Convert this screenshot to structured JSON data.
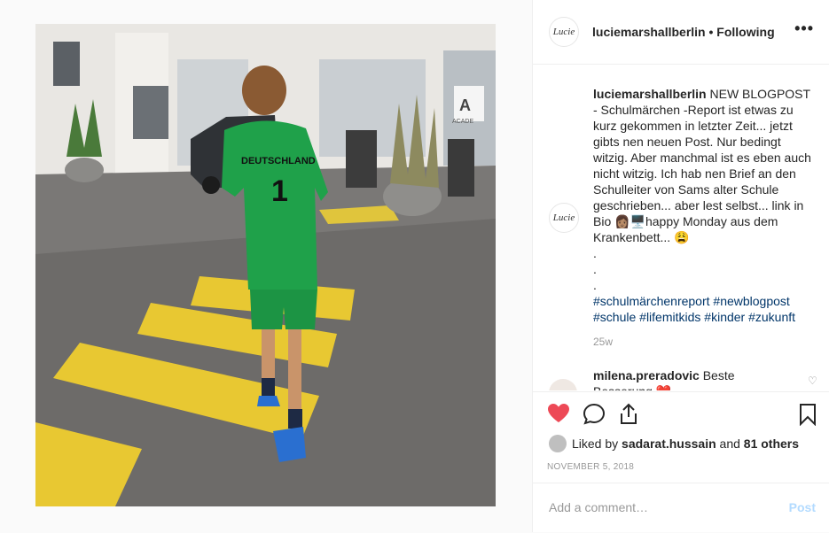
{
  "post": {
    "account": "luciemarshallberlin",
    "avatar_text": "Lucie",
    "follow_separator": "•",
    "follow_status": "Following",
    "more_label": "•••"
  },
  "caption": {
    "username": "luciemarshallberlin",
    "text": "NEW BLOGPOST - Schulmärchen -Report ist etwas zu kurz gekommen in letzter Zeit... jetzt gibts nen neuen Post. Nur bedingt witzig. Aber manchmal ist es eben auch nicht witzig. Ich hab nen Brief an den Schulleiter von Sams alter Schule geschrieben... aber lest selbst... link in Bio 👩🏽🖥️happy Monday aus dem Krankenbett... 😩",
    "dots": [
      ".",
      ".",
      "."
    ],
    "hashtags": [
      "#schulmärchenreport",
      "#newblogpost",
      "#schule",
      "#lifemitkids",
      "#kinder",
      "#zukunft"
    ],
    "time": "25w"
  },
  "comment": {
    "username": "milena.preradovic",
    "text": "Beste Besserung ❤️"
  },
  "likes": {
    "prefix": "Liked by",
    "user": "sadarat.hussain",
    "conjunction": "and",
    "others": "81 others"
  },
  "date": "NOVEMBER 5, 2018",
  "add_comment": {
    "placeholder": "Add a comment…",
    "post_label": "Post"
  },
  "photo": {
    "jersey_text": "DEUTSCHLAND",
    "jersey_number": "1",
    "sign_text": "ACADE"
  },
  "colors": {
    "like_red": "#ed4956",
    "link_blue": "#003569",
    "post_disabled": "#b3dbff",
    "jersey_green": "#1fa14a",
    "marking_yellow": "#e8c832"
  }
}
